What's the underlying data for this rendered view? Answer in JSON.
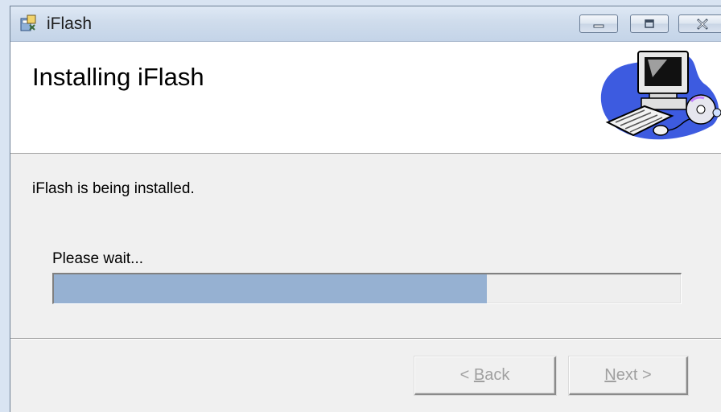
{
  "window": {
    "title": "iFlash",
    "caption_icons": [
      "minimize-icon",
      "maximize-icon",
      "close-icon"
    ]
  },
  "header": {
    "title": "Installing iFlash",
    "art_icon": "computer-cd-setup-icon"
  },
  "body": {
    "status_text": "iFlash is being installed.",
    "wait_label": "Please wait...",
    "progress_fraction": 0.69
  },
  "footer": {
    "back": {
      "arrow": "< ",
      "key": "B",
      "rest": "ack"
    },
    "next": {
      "key": "N",
      "rest": "ext",
      "arrow": " >"
    }
  },
  "colors": {
    "progress_fill": "#96b1d2",
    "disabled_text": "#a0a0a0"
  }
}
